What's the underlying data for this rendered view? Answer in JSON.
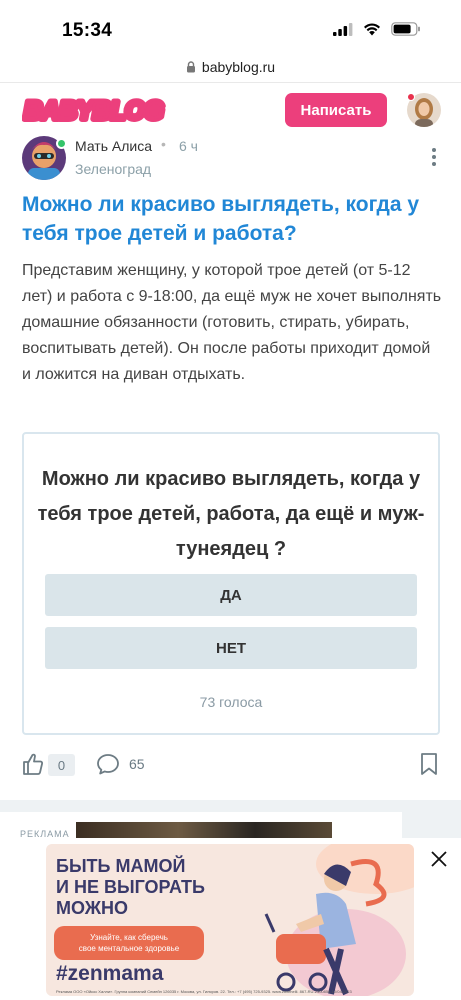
{
  "status_bar": {
    "time": "15:34"
  },
  "browser": {
    "url": "babyblog.ru"
  },
  "header": {
    "logo_text": "BABYBLOG",
    "write_label": "Написать"
  },
  "post": {
    "author": "Мать Алиса",
    "separator": "•",
    "time": "6 ч",
    "city": "Зеленоград",
    "title": "Можно ли красиво выглядеть, когда у тебя трое детей и работа?",
    "body": "Представим женщину, у которой трое детей (от 5-12 лет) и работа с 9-18:00, да ещё муж не хочет выполнять домашние обязанности (готовить, стирать, убирать, воспитывать детей). Он после работы приходит домой и ложится на диван отдыхать.",
    "poll": {
      "question": "Можно ли красиво выглядеть, когда у тебя трое детей, работа, да ещё и муж-тунеядец ?",
      "options": [
        "ДА",
        "НЕТ"
      ],
      "votes": "73 голоса"
    },
    "likes": "0",
    "comments": "65"
  },
  "ad": {
    "label": "РЕКЛАМА",
    "banner_title": "БЫТЬ МАМОЙ\nИ НЕ ВЫГОРАТЬ\nМОЖНО",
    "banner_cta": "Узнайте, как сберечь\nсвое ментальное здоровье",
    "banner_tag": "#zenmama",
    "banner_fine": "Реклама ООО «Ойкос Халли». Группа компаний Семейн 126035 г. Москва, ул. Гиляров. 22. Тел.: +7 (495) 725-9325. www.zoxehelli. 867-RU-2300859-10/04/2023"
  },
  "colors": {
    "accent": "#ec3f7c",
    "title_blue": "#2187d6",
    "online": "#35c46a"
  },
  "icons": [
    "lock-icon",
    "user-avatar",
    "kebab-icon",
    "like-icon",
    "comment-icon",
    "bookmark-icon",
    "close-icon"
  ]
}
